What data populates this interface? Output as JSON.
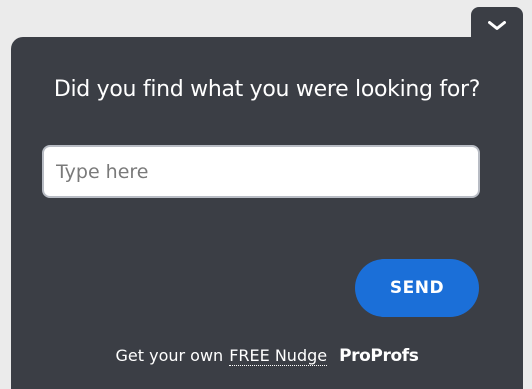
{
  "widget": {
    "question": "Did you find what you were looking for?",
    "input_placeholder": "Type here",
    "input_value": "",
    "send_label": "SEND",
    "collapse_icon": "chevron-down-icon"
  },
  "footer": {
    "prefix": "Get your own",
    "link_text": "FREE Nudge",
    "brand": "ProProfs"
  },
  "colors": {
    "panel": "#3b3e45",
    "send_button": "#1b6fd8",
    "page_background": "#ebebeb"
  }
}
